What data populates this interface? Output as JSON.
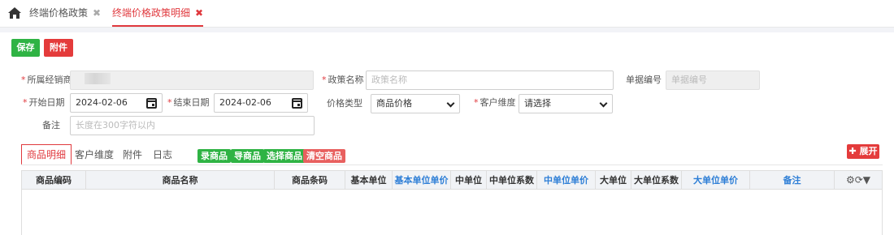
{
  "tabbar": {
    "home_icon": "home-icon",
    "tabs": [
      {
        "label": "终端价格政策",
        "close": "✖"
      },
      {
        "label": "终端价格政策明细",
        "close": "✖"
      }
    ]
  },
  "toolbar": {
    "save_label": "保存",
    "attach_label": "附件"
  },
  "form": {
    "dealer": {
      "label": "所属经销商",
      "value": ""
    },
    "policy_name": {
      "label": "政策名称",
      "placeholder": "政策名称"
    },
    "doc_no": {
      "label": "单据编号",
      "placeholder": "单据编号"
    },
    "start_date": {
      "label": "开始日期",
      "value": "2024-02-06"
    },
    "end_date": {
      "label": "结束日期",
      "value": "2024-02-06"
    },
    "price_type": {
      "label": "价格类型",
      "value": "商品价格"
    },
    "customer_dim": {
      "label": "客户维度",
      "value": "请选择"
    },
    "remark": {
      "label": "备注",
      "placeholder": "长度在300字符以内"
    }
  },
  "subtabs": [
    "商品明细",
    "客户维度",
    "附件",
    "日志"
  ],
  "actions": [
    "录商品",
    "导商品",
    "选择商品",
    "清空商品"
  ],
  "expand_label": "展开",
  "grid": {
    "columns": [
      "商品编码",
      "商品名称",
      "商品条码",
      "基本单位",
      "基本单位单价",
      "中单位",
      "中单位系数",
      "中单位单价",
      "大单位",
      "大单位系数",
      "大单位单价",
      "备注"
    ],
    "tools": "⚙⟳▼"
  },
  "colors": {
    "accent": "#e0393e",
    "green": "#2fb344",
    "blue_header": "#2d7ed6"
  }
}
